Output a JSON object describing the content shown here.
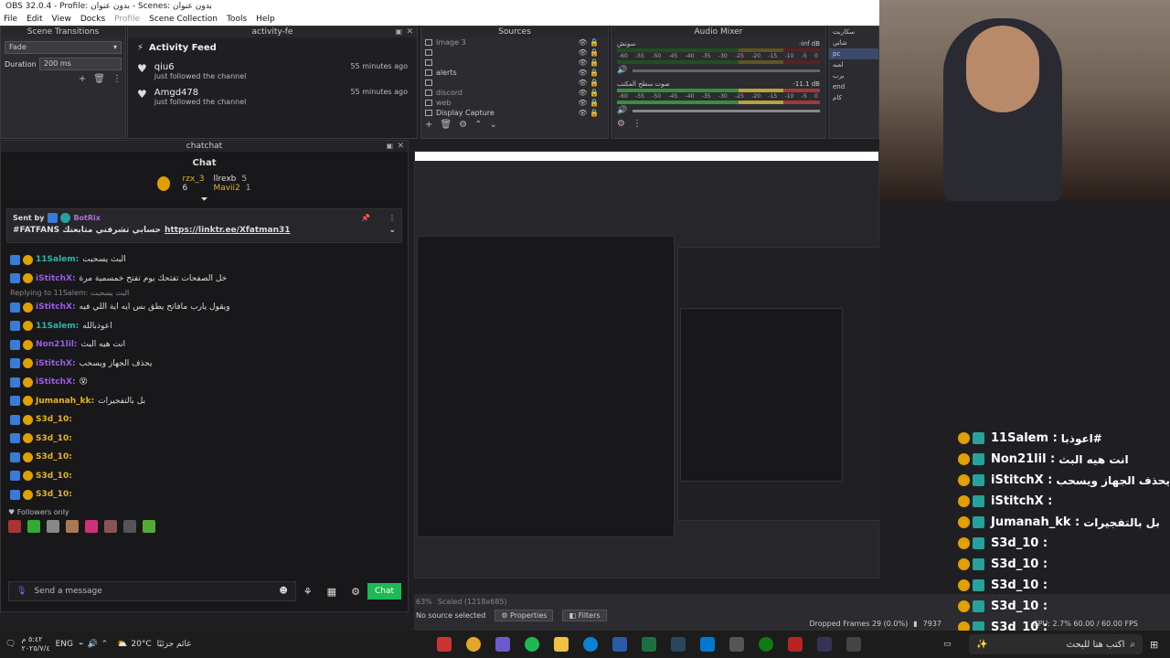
{
  "window": {
    "title": "OBS 32.0.4 - Profile: بدون عنوان - Scenes: بدون عنوان"
  },
  "menu": [
    "File",
    "Edit",
    "View",
    "Docks",
    "Profile",
    "Scene Collection",
    "Tools",
    "Help"
  ],
  "scene_transitions": {
    "title": "Scene Transitions",
    "transition": "Fade",
    "duration_label": "Duration",
    "duration_value": "200 ms"
  },
  "activity": {
    "dock_title": "activity-fe",
    "title": "Activity Feed",
    "items": [
      {
        "name": "qiu6",
        "action": "just followed the channel",
        "time": "55 minutes ago"
      },
      {
        "name": "Amgd478",
        "action": "just followed the channel",
        "time": "55 minutes ago"
      }
    ]
  },
  "sources": {
    "title": "Sources",
    "items": [
      "Image 3",
      "",
      "",
      "alerts",
      "",
      "discord",
      "web",
      "Display Capture"
    ]
  },
  "mixer": {
    "title": "Audio Mixer",
    "ch1": {
      "name": "سوتش",
      "db": "-inf dB"
    },
    "ch2": {
      "name": "صوت سطح المكتب",
      "db": "-11.1 dB"
    },
    "scale": [
      "-60",
      "-55",
      "-50",
      "-45",
      "-40",
      "-35",
      "-30",
      "-25",
      "-20",
      "-15",
      "-10",
      "-5",
      "0"
    ]
  },
  "scenes": {
    "items": [
      "سكاربت",
      "شاتي",
      "pc",
      "لعبه",
      "برب",
      "end",
      "كام"
    ]
  },
  "chat": {
    "dock_title": "chatchat",
    "title": "Chat",
    "leaders": [
      {
        "name": "rzx_3",
        "count": "6"
      },
      {
        "name": "llrexb",
        "count": "5"
      },
      {
        "name": "Mavii2",
        "count": "1"
      }
    ],
    "pinned": {
      "sent_by": "Sent by",
      "bot": "BotRix",
      "text": "#FATFANS حسابي تشرفني متابعتك",
      "link": "https://linktr.ee/Xfatman31"
    },
    "messages": [
      {
        "user": "11Salem:",
        "text": "البث يسحبت"
      },
      {
        "user": "iStitchX:",
        "text": "خل الصفحات تفتحك يوم تفتح خمسمية مرة"
      },
      {
        "reply": "Replying to 11Salem: البث يسحبت"
      },
      {
        "user": "iStitchX:",
        "text": "ويقول يارب مافاتح يطق بس ايه اية اللي فيه"
      },
      {
        "user": "11Salem:",
        "text": "اعوذبالله"
      },
      {
        "user": "Non21lil:",
        "text": "انت هيه البث"
      },
      {
        "user": "iStitchX:",
        "text": "يحذف الجهاز ويسحب"
      },
      {
        "user": "iStitchX:",
        "text": "😵"
      },
      {
        "user": "Jumanah_kk:",
        "text": "بل بالتفجيرات"
      },
      {
        "user": "S3d_10:",
        "text": ""
      },
      {
        "user": "S3d_10:",
        "text": ""
      },
      {
        "user": "S3d_10:",
        "text": ""
      },
      {
        "user": "S3d_10:",
        "text": ""
      },
      {
        "user": "S3d_10:",
        "text": ""
      }
    ],
    "followers_only": "Followers only",
    "input_placeholder": "Send a message",
    "send_label": "Chat"
  },
  "status": {
    "no_source": "No source selected",
    "properties": "Properties",
    "filters": "Filters",
    "zoom": "63%",
    "scaled": "Scaled (1218x685)",
    "dropped": "Dropped Frames 29 (0.0%)",
    "cpu": "CPU: 2.7% 60.00 / 60.00 FPS",
    "rec": "7937"
  },
  "overlay": [
    {
      "user": "11Salem :",
      "text": "اعوذبا#"
    },
    {
      "user": "Non21lil :",
      "text": "انت هيه البث"
    },
    {
      "user": "iStitchX :",
      "text": "يحذف الجهاز ويسحب"
    },
    {
      "user": "iStitchX :",
      "text": ""
    },
    {
      "user": "Jumanah_kk :",
      "text": "بل بالتفجيرات"
    },
    {
      "user": "S3d_10 :",
      "text": ""
    },
    {
      "user": "S3d_10 :",
      "text": ""
    },
    {
      "user": "S3d_10 :",
      "text": ""
    },
    {
      "user": "S3d_10 :",
      "text": ""
    },
    {
      "user": "S3d_10 :",
      "text": ""
    }
  ],
  "taskbar": {
    "time": "٥:٤٢ م",
    "date": "٢٠٢٥/٧/٤",
    "lang": "ENG",
    "weather_temp": "20°C",
    "weather_text": "غائم جزئيًا",
    "search": "اكتب هنا للبحث"
  }
}
